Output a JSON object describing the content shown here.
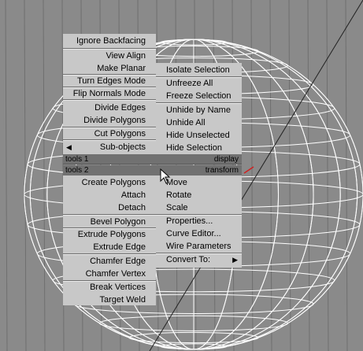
{
  "viewport": {
    "background": "#8a8a8a",
    "wire_color": "#ffffff",
    "grid_color": "#6f6f6f",
    "cursor_icon": "arrow-cursor-icon"
  },
  "left_menu_top": [
    "Ignore Backfacing",
    "View Align",
    "Make Planar",
    "Turn Edges Mode",
    "Flip Normals Mode",
    "Divide Edges",
    "Divide Polygons",
    "Cut Polygons",
    "Sub-objects"
  ],
  "right_menu_top": [
    "Isolate Selection",
    "Unfreeze All",
    "Freeze Selection",
    "Unhide by Name",
    "Unhide All",
    "Hide Unselected",
    "Hide Selection"
  ],
  "quad_labels": {
    "tools1": "tools 1",
    "display": "display",
    "tools2": "tools 2",
    "transform": "transform"
  },
  "left_menu_bottom": [
    "Create Polygons",
    "Attach",
    "Detach",
    "Bevel Polygon",
    "Extrude Polygons",
    "Extrude Edge",
    "Chamfer Edge",
    "Chamfer Vertex",
    "Break Vertices",
    "Target Weld"
  ],
  "right_menu_bottom": [
    "Move",
    "Rotate",
    "Scale",
    "Properties...",
    "Curve Editor...",
    "Wire Parameters",
    "Convert To:"
  ],
  "icons": {
    "submenu_left": "triangle-left-icon",
    "submenu_right": "triangle-right-icon"
  },
  "colors": {
    "menu_bg": "#c8c8c8",
    "header_bar": "#717171",
    "text": "#000000"
  }
}
